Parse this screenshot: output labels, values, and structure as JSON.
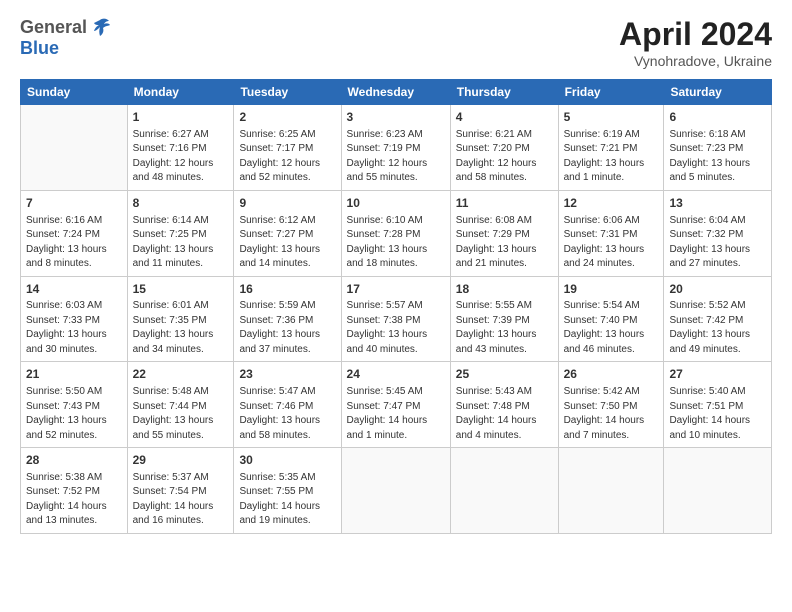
{
  "header": {
    "logo_general": "General",
    "logo_blue": "Blue",
    "title": "April 2024",
    "subtitle": "Vynohradove, Ukraine"
  },
  "weekdays": [
    "Sunday",
    "Monday",
    "Tuesday",
    "Wednesday",
    "Thursday",
    "Friday",
    "Saturday"
  ],
  "weeks": [
    [
      {
        "num": "",
        "info": ""
      },
      {
        "num": "1",
        "info": "Sunrise: 6:27 AM\nSunset: 7:16 PM\nDaylight: 12 hours\nand 48 minutes."
      },
      {
        "num": "2",
        "info": "Sunrise: 6:25 AM\nSunset: 7:17 PM\nDaylight: 12 hours\nand 52 minutes."
      },
      {
        "num": "3",
        "info": "Sunrise: 6:23 AM\nSunset: 7:19 PM\nDaylight: 12 hours\nand 55 minutes."
      },
      {
        "num": "4",
        "info": "Sunrise: 6:21 AM\nSunset: 7:20 PM\nDaylight: 12 hours\nand 58 minutes."
      },
      {
        "num": "5",
        "info": "Sunrise: 6:19 AM\nSunset: 7:21 PM\nDaylight: 13 hours\nand 1 minute."
      },
      {
        "num": "6",
        "info": "Sunrise: 6:18 AM\nSunset: 7:23 PM\nDaylight: 13 hours\nand 5 minutes."
      }
    ],
    [
      {
        "num": "7",
        "info": "Sunrise: 6:16 AM\nSunset: 7:24 PM\nDaylight: 13 hours\nand 8 minutes."
      },
      {
        "num": "8",
        "info": "Sunrise: 6:14 AM\nSunset: 7:25 PM\nDaylight: 13 hours\nand 11 minutes."
      },
      {
        "num": "9",
        "info": "Sunrise: 6:12 AM\nSunset: 7:27 PM\nDaylight: 13 hours\nand 14 minutes."
      },
      {
        "num": "10",
        "info": "Sunrise: 6:10 AM\nSunset: 7:28 PM\nDaylight: 13 hours\nand 18 minutes."
      },
      {
        "num": "11",
        "info": "Sunrise: 6:08 AM\nSunset: 7:29 PM\nDaylight: 13 hours\nand 21 minutes."
      },
      {
        "num": "12",
        "info": "Sunrise: 6:06 AM\nSunset: 7:31 PM\nDaylight: 13 hours\nand 24 minutes."
      },
      {
        "num": "13",
        "info": "Sunrise: 6:04 AM\nSunset: 7:32 PM\nDaylight: 13 hours\nand 27 minutes."
      }
    ],
    [
      {
        "num": "14",
        "info": "Sunrise: 6:03 AM\nSunset: 7:33 PM\nDaylight: 13 hours\nand 30 minutes."
      },
      {
        "num": "15",
        "info": "Sunrise: 6:01 AM\nSunset: 7:35 PM\nDaylight: 13 hours\nand 34 minutes."
      },
      {
        "num": "16",
        "info": "Sunrise: 5:59 AM\nSunset: 7:36 PM\nDaylight: 13 hours\nand 37 minutes."
      },
      {
        "num": "17",
        "info": "Sunrise: 5:57 AM\nSunset: 7:38 PM\nDaylight: 13 hours\nand 40 minutes."
      },
      {
        "num": "18",
        "info": "Sunrise: 5:55 AM\nSunset: 7:39 PM\nDaylight: 13 hours\nand 43 minutes."
      },
      {
        "num": "19",
        "info": "Sunrise: 5:54 AM\nSunset: 7:40 PM\nDaylight: 13 hours\nand 46 minutes."
      },
      {
        "num": "20",
        "info": "Sunrise: 5:52 AM\nSunset: 7:42 PM\nDaylight: 13 hours\nand 49 minutes."
      }
    ],
    [
      {
        "num": "21",
        "info": "Sunrise: 5:50 AM\nSunset: 7:43 PM\nDaylight: 13 hours\nand 52 minutes."
      },
      {
        "num": "22",
        "info": "Sunrise: 5:48 AM\nSunset: 7:44 PM\nDaylight: 13 hours\nand 55 minutes."
      },
      {
        "num": "23",
        "info": "Sunrise: 5:47 AM\nSunset: 7:46 PM\nDaylight: 13 hours\nand 58 minutes."
      },
      {
        "num": "24",
        "info": "Sunrise: 5:45 AM\nSunset: 7:47 PM\nDaylight: 14 hours\nand 1 minute."
      },
      {
        "num": "25",
        "info": "Sunrise: 5:43 AM\nSunset: 7:48 PM\nDaylight: 14 hours\nand 4 minutes."
      },
      {
        "num": "26",
        "info": "Sunrise: 5:42 AM\nSunset: 7:50 PM\nDaylight: 14 hours\nand 7 minutes."
      },
      {
        "num": "27",
        "info": "Sunrise: 5:40 AM\nSunset: 7:51 PM\nDaylight: 14 hours\nand 10 minutes."
      }
    ],
    [
      {
        "num": "28",
        "info": "Sunrise: 5:38 AM\nSunset: 7:52 PM\nDaylight: 14 hours\nand 13 minutes."
      },
      {
        "num": "29",
        "info": "Sunrise: 5:37 AM\nSunset: 7:54 PM\nDaylight: 14 hours\nand 16 minutes."
      },
      {
        "num": "30",
        "info": "Sunrise: 5:35 AM\nSunset: 7:55 PM\nDaylight: 14 hours\nand 19 minutes."
      },
      {
        "num": "",
        "info": ""
      },
      {
        "num": "",
        "info": ""
      },
      {
        "num": "",
        "info": ""
      },
      {
        "num": "",
        "info": ""
      }
    ]
  ]
}
